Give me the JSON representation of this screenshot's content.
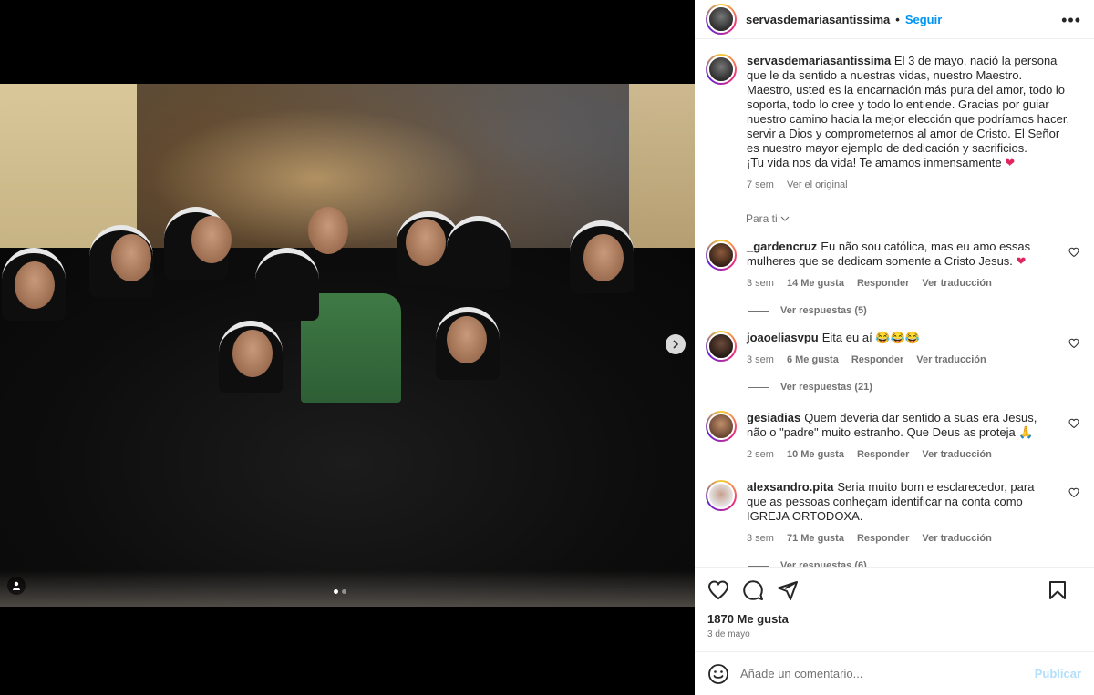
{
  "post": {
    "username": "servasdemariasantissima",
    "follow_label": "Seguir",
    "more_label": "•••",
    "header_dot": "•"
  },
  "caption": {
    "username": "servasdemariasantissima",
    "lines": [
      "El 3 de mayo, nació la persona que le da sentido a nuestras vidas, nuestro Maestro.",
      "Maestro, usted es la encarnación más pura del amor, todo lo soporta, todo lo cree y todo lo entiende. Gracias por guiar nuestro camino hacia la mejor elección que podríamos hacer, servir a Dios y comprometernos al amor de Cristo. El Señor es nuestro mayor ejemplo de dedicación y sacrificios.",
      "¡Tu vida nos da vida! Te amamos inmensamente"
    ],
    "heart": "❤",
    "time": "7 sem",
    "see_original": "Ver el original"
  },
  "sort_label": "Para ti",
  "sort_chevron": "chevron-down-icon",
  "comments": [
    {
      "username": "_gardencruz",
      "text": "Eu não sou católica, mas eu amo essas mulheres que se dedicam somente a Cristo Jesus.",
      "suffix": "❤",
      "time": "3 sem",
      "likes": "14 Me gusta",
      "reply": "Responder",
      "translate": "Ver traducción",
      "replies": "Ver respuestas (5)"
    },
    {
      "username": "joaoeliasvpu",
      "text": "Eita eu aí",
      "suffix": "😂😂😂",
      "time": "3 sem",
      "likes": "6 Me gusta",
      "reply": "Responder",
      "translate": "Ver traducción",
      "replies": "Ver respuestas (21)"
    },
    {
      "username": "gesiadias",
      "text": "Quem deveria dar sentido a suas era Jesus, não o \"padre\" muito estranho. Que Deus as proteja",
      "suffix": "🙏",
      "time": "2 sem",
      "likes": "10 Me gusta",
      "reply": "Responder",
      "translate": "Ver traducción",
      "replies": ""
    },
    {
      "username": "alexsandro.pita",
      "text": "Seria muito bom e esclarecedor, para que as pessoas conheçam identificar na conta como IGREJA ORTODOXA.",
      "suffix": "",
      "time": "3 sem",
      "likes": "71 Me gusta",
      "reply": "Responder",
      "translate": "Ver traducción",
      "replies": "Ver respuestas (6)"
    }
  ],
  "footer": {
    "likes": "1870 Me gusta",
    "date": "3 de mayo",
    "comment_placeholder": "Añade un comentario...",
    "publish_label": "Publicar"
  },
  "carousel": {
    "slides": 2,
    "active_slide": 1
  },
  "colors": {
    "accent": "#0095f6",
    "heart": "#e0245e",
    "muted": "#737373"
  }
}
